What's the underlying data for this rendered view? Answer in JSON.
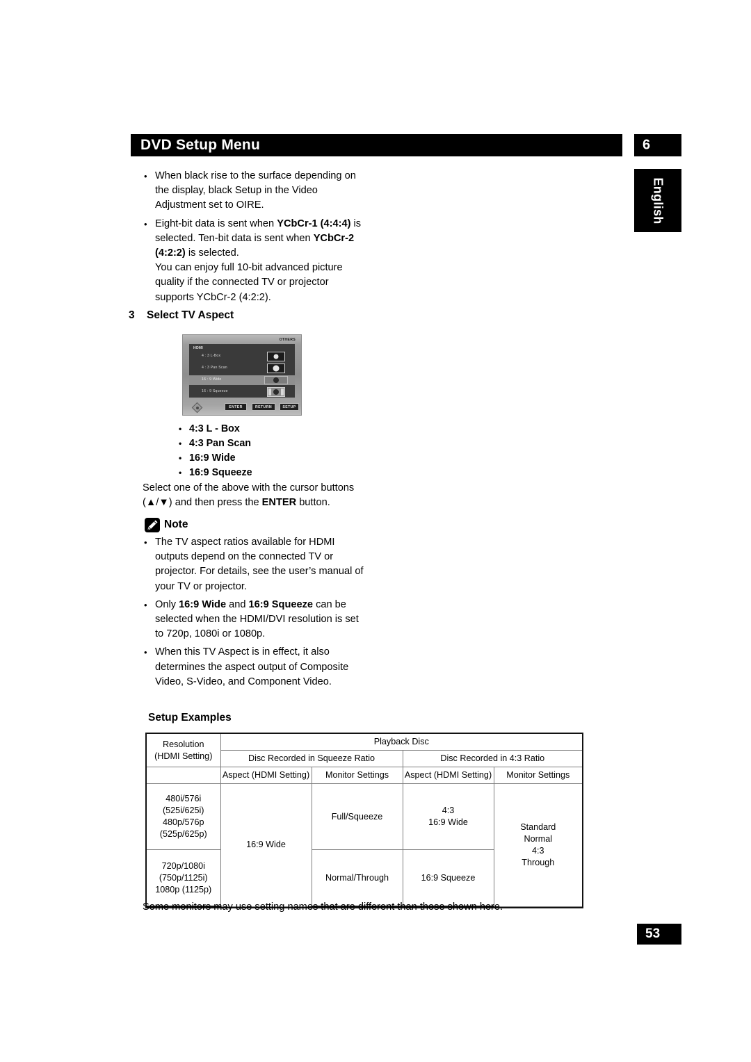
{
  "header": {
    "title": "DVD Setup Menu",
    "chapter": "6",
    "language_tab": "English"
  },
  "intro_bullets": [
    {
      "parts": [
        {
          "t": "When black rise to the surface depending on the display, black Setup in the Video Adjustment set to OIRE.",
          "b": false
        }
      ]
    },
    {
      "parts": [
        {
          "t": "Eight-bit data is sent when ",
          "b": false
        },
        {
          "t": "YCbCr-1 (4:4:4)",
          "b": true
        },
        {
          "t": " is selected. Ten-bit data is sent when ",
          "b": false
        },
        {
          "t": "YCbCr-2 (4:2:2)",
          "b": true
        },
        {
          "t": " is selected.",
          "b": false
        },
        {
          "t": "\nYou can enjoy full 10-bit advanced picture quality if the connected TV or projector supports YCbCr-2 (4:2:2).",
          "b": false
        }
      ]
    }
  ],
  "step": {
    "number": "3",
    "label": "Select TV Aspect"
  },
  "osd": {
    "others_label": "OTHERS",
    "group_label": "HDMI",
    "rows": [
      {
        "label": "4 : 3 L-Box",
        "icon": "aspect-letterbox-icon",
        "selected": false
      },
      {
        "label": "4 : 3 Pan Scan",
        "icon": "aspect-panscan-icon",
        "selected": false
      },
      {
        "label": "16 : 9  Wide",
        "icon": "aspect-wide-icon",
        "selected": true
      },
      {
        "label": "16 : 9 Squeeze",
        "icon": "aspect-squeeze-icon",
        "selected": false
      }
    ],
    "buttons": [
      "ENTER",
      "RETURN",
      "SETUP"
    ],
    "dpad_icon": "dpad-icon"
  },
  "aspect_options": [
    "4:3 L - Box",
    "4:3 Pan Scan",
    "16:9 Wide",
    "16:9 Squeeze"
  ],
  "select_instruction": {
    "line1": "Select one of the above with the cursor buttons",
    "line2_pre": "(▲/▼) and then press the ",
    "line2_bold": "ENTER",
    "line2_post": " button."
  },
  "note": {
    "icon": "pencil-icon",
    "label": "Note",
    "bullets": [
      {
        "parts": [
          {
            "t": "The TV aspect ratios available for HDMI outputs depend on the connected TV or projector. For details, see the user’s manual of your TV or projector.",
            "b": false
          }
        ]
      },
      {
        "parts": [
          {
            "t": "Only ",
            "b": false
          },
          {
            "t": "16:9 Wide",
            "b": true
          },
          {
            "t": " and ",
            "b": false
          },
          {
            "t": "16:9 Squeeze",
            "b": true
          },
          {
            "t": " can be selected when the HDMI/DVI resolution is set to 720p, 1080i or 1080p.",
            "b": false
          }
        ]
      },
      {
        "parts": [
          {
            "t": "When this TV Aspect is in effect, it also determines the aspect output of Composite Video, S-Video, and Component Video.",
            "b": false
          }
        ]
      }
    ]
  },
  "setup_examples": {
    "title": "Setup Examples",
    "table": {
      "header_resolution": "Resolution\n(HDMI Setting)",
      "header_playback_disc": "Playback Disc",
      "header_squeeze_group": "Disc Recorded in Squeeze Ratio",
      "header_43_group": "Disc Recorded in 4:3 Ratio",
      "header_aspect_1": "Aspect (HDMI Setting)",
      "header_monitor_1": "Monitor Settings",
      "header_aspect_2": "Aspect (HDMI Setting)",
      "header_monitor_2": "Monitor Settings",
      "row1_resolution": "480i/576i\n(525i/625i)\n480p/576p\n(525p/625p)",
      "row2_resolution": "720p/1080i\n(750p/1125i)\n1080p (1125p)",
      "aspect_squeeze_merged": "16:9 Wide",
      "row1_monitor_squeeze": "Full/Squeeze",
      "row2_monitor_squeeze": "Normal/Through",
      "row1_aspect_43": "4:3\n16:9 Wide",
      "row2_aspect_43": "16:9 Squeeze",
      "monitor_43_merged": "Standard\nNormal\n4:3\nThrough"
    }
  },
  "closing_note": "Some monitors may use setting names that are different than those shown here.",
  "page_number": "53"
}
